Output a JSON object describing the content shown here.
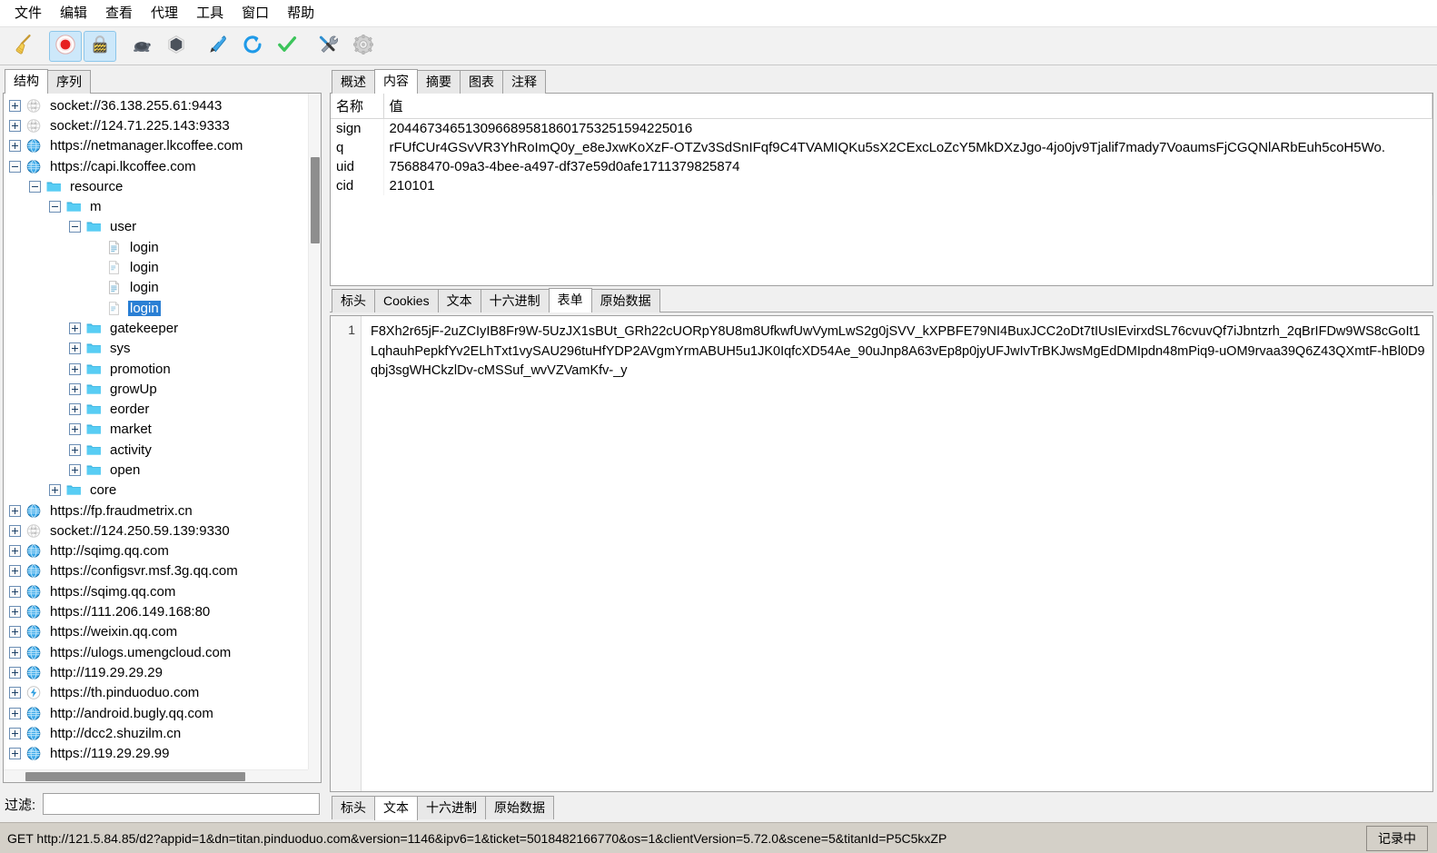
{
  "menu": {
    "items": [
      {
        "label": "文件",
        "name": "menu-file"
      },
      {
        "label": "编辑",
        "name": "menu-edit"
      },
      {
        "label": "查看",
        "name": "menu-view"
      },
      {
        "label": "代理",
        "name": "menu-proxy"
      },
      {
        "label": "工具",
        "name": "menu-tools"
      },
      {
        "label": "窗口",
        "name": "menu-window"
      },
      {
        "label": "帮助",
        "name": "menu-help"
      }
    ]
  },
  "toolbar": {
    "buttons": [
      {
        "icon": "broom-icon",
        "active": false
      },
      {
        "icon": "record-icon",
        "active": true
      },
      {
        "icon": "lock-icon",
        "active": true
      },
      {
        "icon": "turtle-icon",
        "active": false
      },
      {
        "icon": "hexagon-icon",
        "active": false
      },
      {
        "icon": "pen-icon",
        "active": false
      },
      {
        "icon": "refresh-icon",
        "active": false
      },
      {
        "icon": "checkmark-icon",
        "active": false
      },
      {
        "icon": "tools-icon",
        "active": false
      },
      {
        "icon": "gear-icon",
        "active": false
      }
    ]
  },
  "left": {
    "tabs": [
      {
        "label": "结构",
        "selected": true
      },
      {
        "label": "序列",
        "selected": false
      }
    ],
    "tree": [
      {
        "label": "socket://36.138.255.61:9443",
        "depth": 0,
        "toggle": "plus",
        "icon": "socket-icon"
      },
      {
        "label": "socket://124.71.225.143:9333",
        "depth": 0,
        "toggle": "plus",
        "icon": "socket-icon"
      },
      {
        "label": "https://netmanager.lkcoffee.com",
        "depth": 0,
        "toggle": "plus",
        "icon": "globe-icon"
      },
      {
        "label": "https://capi.lkcoffee.com",
        "depth": 0,
        "toggle": "minus",
        "icon": "globe-icon"
      },
      {
        "label": "resource",
        "depth": 1,
        "toggle": "minus",
        "icon": "folder-icon"
      },
      {
        "label": "m",
        "depth": 2,
        "toggle": "minus",
        "icon": "folder-icon"
      },
      {
        "label": "user",
        "depth": 3,
        "toggle": "minus",
        "icon": "folder-icon"
      },
      {
        "label": "login",
        "depth": 4,
        "toggle": "none",
        "icon": "doc-icon"
      },
      {
        "label": "login",
        "depth": 4,
        "toggle": "none",
        "icon": "doc-partial-icon"
      },
      {
        "label": "login",
        "depth": 4,
        "toggle": "none",
        "icon": "doc-icon"
      },
      {
        "label": "login",
        "depth": 4,
        "toggle": "none",
        "icon": "doc-partial-icon",
        "selected": true
      },
      {
        "label": "gatekeeper",
        "depth": 3,
        "toggle": "plus",
        "icon": "folder-icon"
      },
      {
        "label": "sys",
        "depth": 3,
        "toggle": "plus",
        "icon": "folder-icon"
      },
      {
        "label": "promotion",
        "depth": 3,
        "toggle": "plus",
        "icon": "folder-icon"
      },
      {
        "label": "growUp",
        "depth": 3,
        "toggle": "plus",
        "icon": "folder-icon"
      },
      {
        "label": "eorder",
        "depth": 3,
        "toggle": "plus",
        "icon": "folder-icon"
      },
      {
        "label": "market",
        "depth": 3,
        "toggle": "plus",
        "icon": "folder-icon"
      },
      {
        "label": "activity",
        "depth": 3,
        "toggle": "plus",
        "icon": "folder-icon"
      },
      {
        "label": "open",
        "depth": 3,
        "toggle": "plus",
        "icon": "folder-icon"
      },
      {
        "label": "core",
        "depth": 2,
        "toggle": "plus",
        "icon": "folder-icon"
      },
      {
        "label": "https://fp.fraudmetrix.cn",
        "depth": 0,
        "toggle": "plus",
        "icon": "globe-icon"
      },
      {
        "label": "socket://124.250.59.139:9330",
        "depth": 0,
        "toggle": "plus",
        "icon": "socket-icon"
      },
      {
        "label": "http://sqimg.qq.com",
        "depth": 0,
        "toggle": "plus",
        "icon": "globe-icon"
      },
      {
        "label": "https://configsvr.msf.3g.qq.com",
        "depth": 0,
        "toggle": "plus",
        "icon": "globe-icon"
      },
      {
        "label": "https://sqimg.qq.com",
        "depth": 0,
        "toggle": "plus",
        "icon": "globe-icon"
      },
      {
        "label": "https://111.206.149.168:80",
        "depth": 0,
        "toggle": "plus",
        "icon": "globe-icon"
      },
      {
        "label": "https://weixin.qq.com",
        "depth": 0,
        "toggle": "plus",
        "icon": "globe-icon"
      },
      {
        "label": "https://ulogs.umengcloud.com",
        "depth": 0,
        "toggle": "plus",
        "icon": "globe-icon"
      },
      {
        "label": "http://119.29.29.29",
        "depth": 0,
        "toggle": "plus",
        "icon": "globe-icon"
      },
      {
        "label": "https://th.pinduoduo.com",
        "depth": 0,
        "toggle": "plus",
        "icon": "bolt-icon"
      },
      {
        "label": "http://android.bugly.qq.com",
        "depth": 0,
        "toggle": "plus",
        "icon": "globe-icon"
      },
      {
        "label": "http://dcc2.shuzilm.cn",
        "depth": 0,
        "toggle": "plus",
        "icon": "globe-icon"
      },
      {
        "label": "https://119.29.29.99",
        "depth": 0,
        "toggle": "plus",
        "icon": "globe-icon"
      }
    ],
    "filter": {
      "label": "过滤:",
      "value": "",
      "placeholder": ""
    }
  },
  "request": {
    "tabs": [
      {
        "label": "概述",
        "selected": false
      },
      {
        "label": "内容",
        "selected": true
      },
      {
        "label": "摘要",
        "selected": false
      },
      {
        "label": "图表",
        "selected": false
      },
      {
        "label": "注释",
        "selected": false
      }
    ],
    "subtabs": [
      {
        "label": "标头",
        "selected": false
      },
      {
        "label": "Cookies",
        "selected": false
      },
      {
        "label": "文本",
        "selected": false
      },
      {
        "label": "十六进制",
        "selected": false
      },
      {
        "label": "表单",
        "selected": true
      },
      {
        "label": "原始数据",
        "selected": false
      }
    ],
    "table": {
      "headers": [
        "名称",
        "值"
      ],
      "rows": [
        {
          "name": "sign",
          "value": "2044673465130966895818601753251594225016"
        },
        {
          "name": "q",
          "value": "rFUfCUr4GSvVR3YhRoImQ0y_e8eJxwKoXzF-OTZv3SdSnIFqf9C4TVAMIQKu5sX2CExcLoZcY5MkDXzJgo-4jo0jv9Tjalif7mady7VoaumsFjCGQNlARbEuh5coH5Wo."
        },
        {
          "name": "uid",
          "value": "75688470-09a3-4bee-a497-df37e59d0afe1711379825874"
        },
        {
          "name": "cid",
          "value": "210101"
        }
      ]
    }
  },
  "response": {
    "subtabs": [
      {
        "label": "标头",
        "selected": false
      },
      {
        "label": "文本",
        "selected": true
      },
      {
        "label": "十六进制",
        "selected": false
      },
      {
        "label": "原始数据",
        "selected": false
      }
    ],
    "line_number": "1",
    "body": "F8Xh2r65jF-2uZCIyIB8Fr9W-5UzJX1sBUt_GRh22cUORpY8U8m8UfkwfUwVymLwS2g0jSVV_kXPBFE79NI4BuxJCC2oDt7tIUsIEvirxdSL76cvuvQf7iJbntzrh_2qBrIFDw9WS8cGoIt1LqhauhPepkfYv2ELhTxt1vySAU296tuHfYDP2AVgmYrmABUH5u1JK0IqfcXD54Ae_90uJnp8A63vEp8p0jyUFJwIvTrBKJwsMgEdDMIpdn48mPiq9-uOM9rvaa39Q6Z43QXmtF-hBl0D9qbj3sgWHCkzlDv-cMSSuf_wvVZVamKfv-_y"
  },
  "statusbar": {
    "text": "GET http://121.5.84.85/d2?appid=1&dn=titan.pinduoduo.com&version=1146&ipv6=1&ticket=5018482166770&os=1&clientVersion=5.72.0&scene=5&titanId=P5C5kxZP",
    "recording_label": "记录中"
  },
  "colors": {
    "accent": "#2a7fd4",
    "toolbar_active": "#cde8fa",
    "status_bg": "#d4d0c8",
    "folder": "#4cc3ee"
  }
}
